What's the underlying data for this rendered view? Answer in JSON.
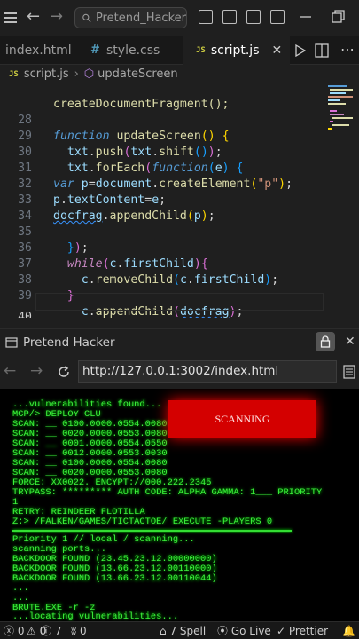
{
  "titlebar": {
    "search_text": "Pretend_Hacker",
    "back_glyph": "←",
    "forward_glyph": "→"
  },
  "tabs": [
    {
      "label": "index.html",
      "active": false
    },
    {
      "label": "style.css",
      "active": false
    },
    {
      "label": "script.js",
      "active": true
    }
  ],
  "breadcrumb": {
    "file": "script.js",
    "symbol": "updateScreen"
  },
  "editor": {
    "top_partial_line": "createDocumentFragment();",
    "lines": [
      {
        "num": "28"
      },
      {
        "num": "29"
      },
      {
        "num": "30"
      },
      {
        "num": "31"
      },
      {
        "num": "32"
      },
      {
        "num": "33"
      },
      {
        "num": "34"
      },
      {
        "num": "35"
      },
      {
        "num": "36"
      },
      {
        "num": "37"
      },
      {
        "num": "38"
      },
      {
        "num": "39"
      },
      {
        "num": "40"
      }
    ]
  },
  "browser": {
    "title": "Pretend Hacker",
    "url": "http://127.0.0.1:3002/index.html"
  },
  "terminal": {
    "scanning_label": "SCANNING",
    "lines": [
      "...vulnerabilities found...",
      "MCP/> DEPLOY CLU",
      "SCAN: __ 0100.0000.0554.0080",
      "SCAN: __ 0020.0000.0553.0080",
      "SCAN: __ 0001.0000.0554.0550",
      "SCAN: __ 0012.0000.0553.0030",
      "SCAN: __ 0100.0000.0554.0080",
      "SCAN: __ 0020.0000.0553.0080",
      "FORCE: XX0022. ENCYPT://000.222.2345",
      "TRYPASS: ********* AUTH CODE: ALPHA GAMMA: 1___ PRIORITY",
      "1",
      "RETRY: REINDEER FLOTILLA",
      "Z:> /FALKEN/GAMES/TICTACTOE/ EXECUTE -PLAYERS 0",
      "Priority 1 // local / scanning...",
      "scanning ports...",
      "BACKDOOR FOUND (23.45.23.12.00000000)",
      "BACKDOOR FOUND (13.66.23.12.00110000)",
      "BACKDOOR FOUND (13.66.23.12.00110044)",
      "...",
      "...",
      "BRUTE.EXE -r -z",
      "...locating vulnerabilities..."
    ]
  },
  "statusbar": {
    "errors": "0",
    "warnings": "0",
    "info": "7",
    "ports": "0",
    "spell": "7 Spell",
    "golive": "Go Live",
    "prettier": "Prettier"
  },
  "colors": {
    "accent": "#0078d4",
    "terminal_green": "#3df23d",
    "scan_red": "#d40000"
  }
}
